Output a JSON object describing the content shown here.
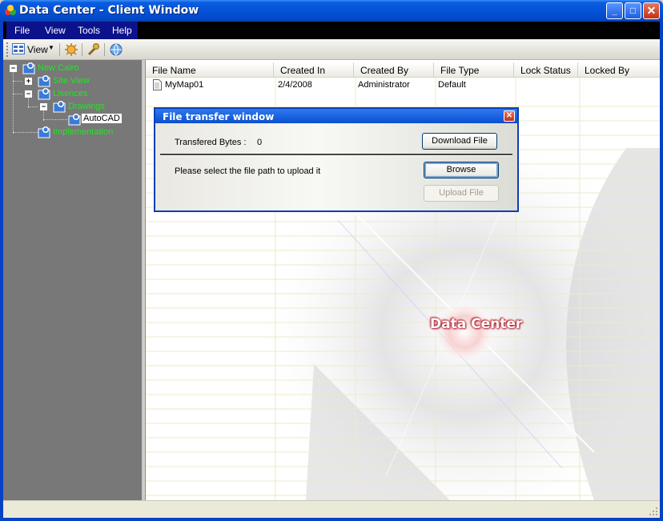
{
  "window": {
    "title": "Data Center - Client Window",
    "minimize": "_",
    "maximize": "□",
    "close": "✕"
  },
  "menu": [
    {
      "label": "File"
    },
    {
      "label": "View"
    },
    {
      "label": "Tools"
    },
    {
      "label": "Help"
    }
  ],
  "toolbar": {
    "view_label": "View",
    "icons": [
      "view-icon",
      "sun-settings-icon",
      "tools-icon",
      "globe-refresh-icon"
    ]
  },
  "tree": {
    "nodes": [
      {
        "label": "New Cairo",
        "expander": "−"
      },
      {
        "label": "Site View",
        "expander": "+"
      },
      {
        "label": "Lisences",
        "expander": "−"
      },
      {
        "label": "Drawings",
        "expander": "−"
      },
      {
        "label": "AutoCAD"
      },
      {
        "label": "Implementation"
      }
    ]
  },
  "grid": {
    "columns": [
      "File Name",
      "Created In",
      "Created By",
      "File Type",
      "Lock Status",
      "Locked By"
    ],
    "rows": [
      {
        "file_name": "MyMap01",
        "created_in": "2/4/2008",
        "created_by": "Administrator",
        "file_type": "Default",
        "lock_status": "",
        "locked_by": ""
      }
    ]
  },
  "watermark": "Data Center",
  "dialog": {
    "title": "File transfer window",
    "close": "✕",
    "bytes_label": "Transfered Bytes :",
    "bytes_value": "0",
    "download_label": "Download File",
    "upload_prompt": "Please select the file path to upload it",
    "browse_label": "Browse",
    "upload_label": "Upload File"
  },
  "colors": {
    "titlebar": "#0553d6",
    "menubar_active": "#0b128b",
    "tree_bg": "#787878",
    "tree_text": "#1ee81e"
  }
}
